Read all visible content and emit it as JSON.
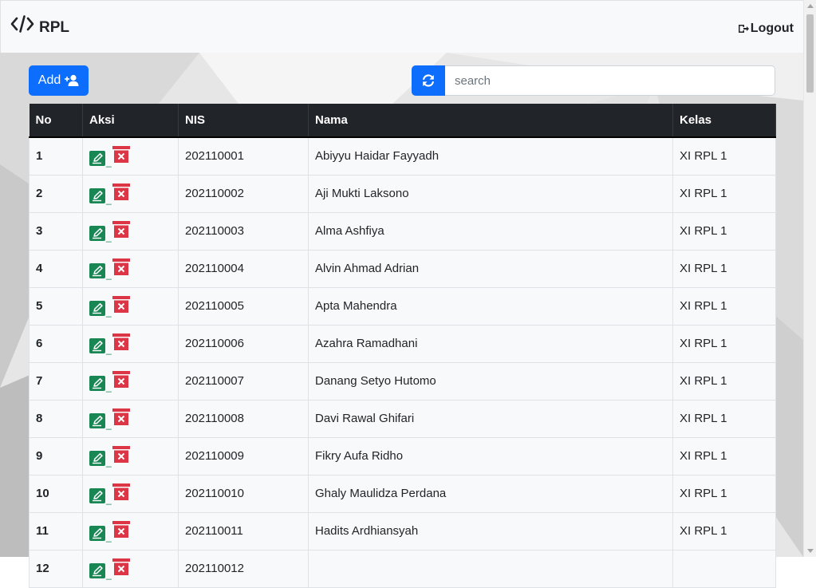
{
  "navbar": {
    "brand": "RPL",
    "logout_label": "Logout"
  },
  "toolbar": {
    "add_label": "Add",
    "search_placeholder": "search",
    "search_value": ""
  },
  "table": {
    "headers": [
      "No",
      "Aksi",
      "NIS",
      "Nama",
      "Kelas"
    ],
    "action_separator": "_",
    "rows": [
      {
        "no": "1",
        "nis": "202110001",
        "nama": "Abiyyu Haidar Fayyadh",
        "kelas": "XI RPL 1"
      },
      {
        "no": "2",
        "nis": "202110002",
        "nama": "Aji Mukti Laksono",
        "kelas": "XI RPL 1"
      },
      {
        "no": "3",
        "nis": "202110003",
        "nama": "Alma Ashfiya",
        "kelas": "XI RPL 1"
      },
      {
        "no": "4",
        "nis": "202110004",
        "nama": "Alvin Ahmad Adrian",
        "kelas": "XI RPL 1"
      },
      {
        "no": "5",
        "nis": "202110005",
        "nama": "Apta Mahendra",
        "kelas": "XI RPL 1"
      },
      {
        "no": "6",
        "nis": "202110006",
        "nama": "Azahra Ramadhani",
        "kelas": "XI RPL 1"
      },
      {
        "no": "7",
        "nis": "202110007",
        "nama": "Danang Setyo Hutomo",
        "kelas": "XI RPL 1"
      },
      {
        "no": "8",
        "nis": "202110008",
        "nama": "Davi Rawal Ghifari",
        "kelas": "XI RPL 1"
      },
      {
        "no": "9",
        "nis": "202110009",
        "nama": "Fikry Aufa Ridho",
        "kelas": "XI RPL 1"
      },
      {
        "no": "10",
        "nis": "202110010",
        "nama": "Ghaly Maulidza Perdana",
        "kelas": "XI RPL 1"
      },
      {
        "no": "11",
        "nis": "202110011",
        "nama": "Hadits Ardhiansyah",
        "kelas": "XI RPL 1"
      },
      {
        "no": "12",
        "nis": "202110012",
        "nama": "",
        "kelas": ""
      }
    ]
  },
  "icons": {
    "brand": "code-icon",
    "logout": "logout-icon",
    "add": "user-plus-icon",
    "refresh": "refresh-icon",
    "edit": "edit-icon",
    "delete": "delete-icon"
  },
  "colors": {
    "primary": "#0d6efd",
    "edit": "#198754",
    "delete": "#dc3545",
    "table_header": "#212529"
  }
}
